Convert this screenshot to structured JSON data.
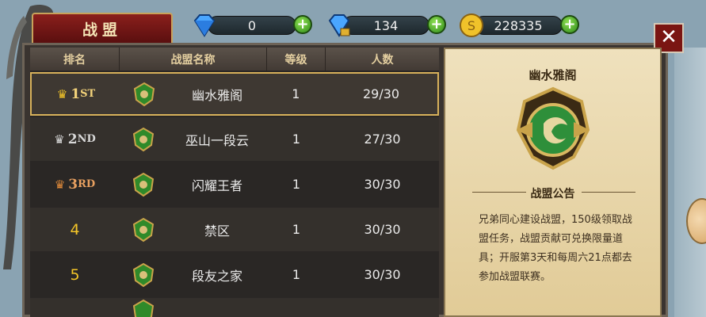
{
  "header": {
    "title": "战盟"
  },
  "currencies": [
    {
      "icon": "blue-diamond-icon",
      "value": "0"
    },
    {
      "icon": "locked-diamond-icon",
      "value": "134"
    },
    {
      "icon": "gold-coin-icon",
      "value": "228335"
    }
  ],
  "table": {
    "headers": [
      "排名",
      "战盟名称",
      "等级",
      "人数"
    ],
    "rows": [
      {
        "rank": "1",
        "rank_suffix": "ST",
        "crown": "gold",
        "name": "幽水雅阁",
        "level": "1",
        "members": "29/30"
      },
      {
        "rank": "2",
        "rank_suffix": "ND",
        "crown": "silver",
        "name": "巫山一段云",
        "level": "1",
        "members": "27/30"
      },
      {
        "rank": "3",
        "rank_suffix": "RD",
        "crown": "bronze",
        "name": "闪耀王者",
        "level": "1",
        "members": "30/30"
      },
      {
        "rank": "4",
        "rank_suffix": "",
        "crown": "",
        "name": "禁区",
        "level": "1",
        "members": "30/30"
      },
      {
        "rank": "5",
        "rank_suffix": "",
        "crown": "",
        "name": "段友之家",
        "level": "1",
        "members": "30/30"
      }
    ]
  },
  "detail": {
    "guild_name": "幽水雅阁",
    "notice_title": "战盟公告",
    "notice_text": "兄弟同心建设战盟，150级领取战盟任务，战盟贡献可兑换限量道具；开服第3天和每周六21点都去参加战盟联赛。"
  },
  "colors": {
    "accent_gold": "#d7b15a",
    "title_red": "#7a1512",
    "parchment": "#e9d8ab"
  }
}
